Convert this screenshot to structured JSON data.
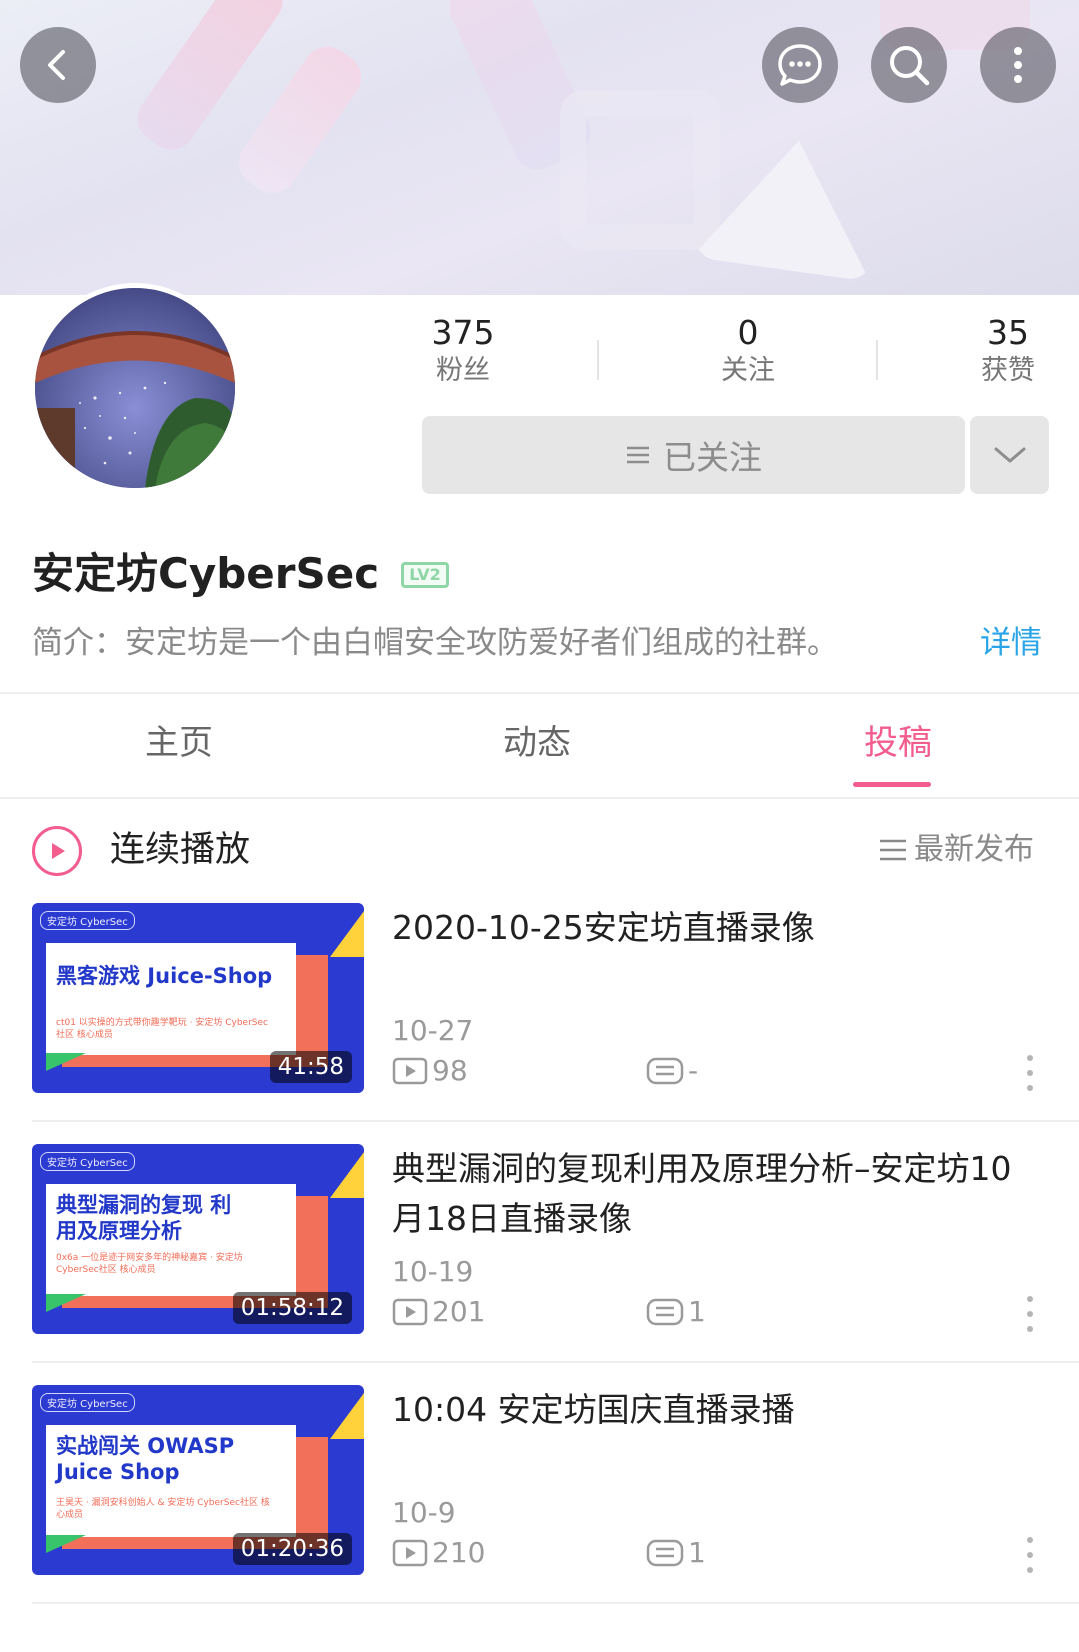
{
  "header": {
    "back_icon": "chevron-left-icon",
    "chat_icon": "chat-bubble-icon",
    "search_icon": "search-icon",
    "more_icon": "more-vertical-icon"
  },
  "profile": {
    "stats": [
      {
        "value": "375",
        "label": "粉丝"
      },
      {
        "value": "0",
        "label": "关注"
      },
      {
        "value": "35",
        "label": "获赞"
      }
    ],
    "follow_button_label": "已关注",
    "username": "安定坊CyberSec",
    "level_badge": "LV2",
    "bio": "简介：安定坊是一个由白帽安全攻防爱好者们组成的社群。",
    "bio_detail_link": "详情"
  },
  "tabs": [
    {
      "label": "主页",
      "active": false
    },
    {
      "label": "动态",
      "active": false
    },
    {
      "label": "投稿",
      "active": true
    }
  ],
  "playlist": {
    "continuous_play_label": "连续播放",
    "sort_label": "最新发布"
  },
  "videos": [
    {
      "title": "2020-10-25安定坊直播录像",
      "date": "10-27",
      "views": "98",
      "comments": "-",
      "duration": "41:58",
      "thumb_tag": "安定坊 CyberSec",
      "thumb_title": "黑客游戏 Juice-Shop",
      "thumb_sub": "ct01 以实操的方式带你趣学靶玩 · 安定坊 CyberSec社区 核心成员"
    },
    {
      "title": "典型漏洞的复现利用及原理分析–安定坊10月18日直播录像",
      "date": "10-19",
      "views": "201",
      "comments": "1",
      "duration": "01:58:12",
      "thumb_tag": "安定坊 CyberSec",
      "thumb_title": "典型漏洞的复现 利用及原理分析",
      "thumb_sub": "0x6a 一位是迹于网安多年的神秘嘉宾 · 安定坊 CyberSec社区 核心成员"
    },
    {
      "title": "10:04  安定坊国庆直播录播",
      "date": "10-9",
      "views": "210",
      "comments": "1",
      "duration": "01:20:36",
      "thumb_tag": "安定坊 CyberSec",
      "thumb_title": "实战闯关 OWASP Juice Shop",
      "thumb_sub": "王昊天 · 漏洞安科创始人 & 安定坊 CyberSec社区 核心成员"
    }
  ],
  "colors": {
    "accent_pink": "#f25d8e",
    "link_blue": "#2aa4e8",
    "level_green": "#8ed6a5",
    "thumb_blue": "#2b3ad0"
  }
}
